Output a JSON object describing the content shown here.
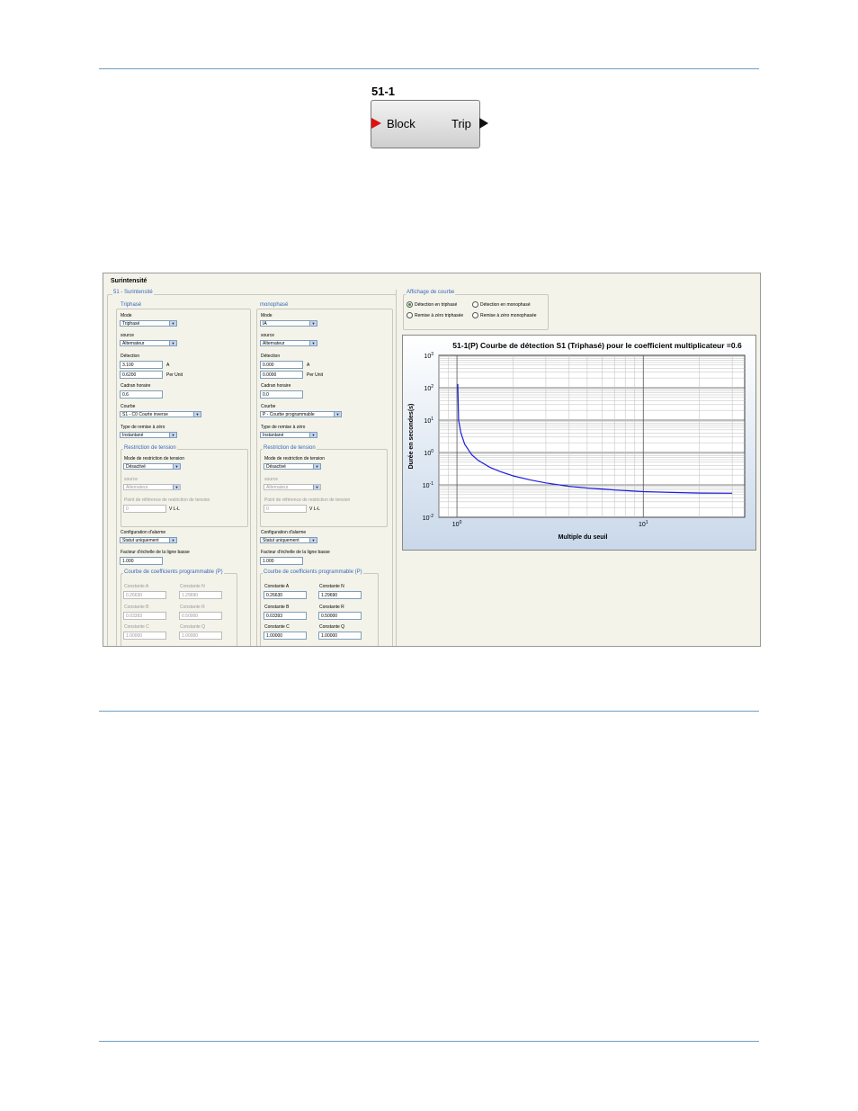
{
  "block": {
    "title": "51-1",
    "input_label": "Block",
    "output_label": "Trip"
  },
  "window": {
    "title": "Surintensité",
    "group_title": "51 - Surintensité"
  },
  "triphase": {
    "title": "Triphasé",
    "mode_label": "Mode",
    "mode_value": "Triphasé",
    "source_label": "source",
    "source_value": "Alternateur",
    "detection_label": "Détection",
    "detection_value": "3.100",
    "detection_unit": "A",
    "perunit_value": "0.6200",
    "perunit_unit": "Per Unit",
    "cadran_label": "Cadran horaire",
    "cadran_value": "0.6",
    "courbe_label": "Courbe",
    "courbe_value": "S1 - C0 Courte inverse",
    "reset_label": "Type de remise à zéro",
    "reset_value": "Instantané",
    "restriction": {
      "title": "Restriction de tension",
      "mode_label": "Mode de restriction de tension",
      "mode_value": "Désactivé",
      "source_label": "source",
      "source_value": "Alternateur",
      "point_label": "Point de référence de restriction de tension",
      "point_value": "0",
      "point_unit": "V L-L"
    },
    "alarm_label": "Configuration d'alarme",
    "alarm_value": "Statut uniquement",
    "facteur_label": "Facteur d'échelle de la ligne basse",
    "facteur_value": "1.000",
    "coeffs": {
      "title": "Courbe de coefficients programmable (P)",
      "a_label": "Constante A",
      "a_value": "0.26630",
      "n_label": "Constante N",
      "n_value": "1.29690",
      "b_label": "Constante B",
      "b_value": "0.03393",
      "r_label": "Constante R",
      "r_value": "0.50000",
      "c_label": "Constante C",
      "c_value": "1.00000",
      "q_label": "Constante Q",
      "q_value": "1.00000"
    }
  },
  "monophase": {
    "title": "monophasé",
    "mode_label": "Mode",
    "mode_value": "IA",
    "source_label": "source",
    "source_value": "Alternateur",
    "detection_label": "Détection",
    "detection_value": "0.000",
    "detection_unit": "A",
    "perunit_value": "0.0000",
    "perunit_unit": "Per Unit",
    "cadran_label": "Cadran horaire",
    "cadran_value": "0.0",
    "courbe_label": "Courbe",
    "courbe_value": "P - Courbe programmable",
    "reset_label": "Type de remise à zéro",
    "reset_value": "Instantané",
    "restriction": {
      "title": "Restriction de tension",
      "mode_label": "Mode de restriction de tension",
      "mode_value": "Désactivé",
      "source_label": "source",
      "source_value": "Alternateur",
      "point_label": "Point de référence de restriction de tension",
      "point_value": "0",
      "point_unit": "V L-L"
    },
    "alarm_label": "Configuration d'alarme",
    "alarm_value": "Statut uniquement",
    "facteur_label": "Facteur d'échelle de la ligne basse",
    "facteur_value": "1.000",
    "coeffs": {
      "title": "Courbe de coefficients programmable (P)",
      "a_label": "Constante A",
      "a_value": "0.26630",
      "n_label": "Constante N",
      "n_value": "1.29690",
      "b_label": "Constante B",
      "b_value": "0.03393",
      "r_label": "Constante R",
      "r_value": "0.50000",
      "c_label": "Constante C",
      "c_value": "1.00000",
      "q_label": "Constante Q",
      "q_value": "1.00000"
    }
  },
  "affichage": {
    "title": "Affichage de courbe",
    "options": [
      "Détection en triphasé",
      "Détection en monophasé",
      "Remise à zéro triphasée",
      "Remise à zéro monophasée"
    ],
    "selected": 0
  },
  "colors": {
    "curve": "#1f1fdd",
    "accent": "#3a68b8"
  },
  "chart_data": {
    "type": "line",
    "title": "51-1(P) Courbe de détection S1 (Triphasé) pour le coefficient multiplicateur =0.6",
    "xlabel": "Multiple du seuil",
    "ylabel": "Durée en secondes(s)",
    "xscale": "log",
    "yscale": "log",
    "xlim": [
      0.8,
      35
    ],
    "ylim": [
      0.01,
      1000
    ],
    "yticks": [
      "10^3",
      "10^2",
      "10^1",
      "10^0",
      "10^-1",
      "10^-2"
    ],
    "xticks": [
      "10^0",
      "10^1"
    ],
    "grid": true,
    "series": [
      {
        "x": [
          1.01,
          1.02,
          1.05,
          1.1,
          1.2,
          1.3,
          1.5,
          1.7,
          2,
          2.5,
          3,
          4,
          5,
          7,
          10,
          15,
          20,
          30
        ],
        "y": [
          130,
          10,
          4,
          1.8,
          0.85,
          0.57,
          0.35,
          0.26,
          0.19,
          0.14,
          0.115,
          0.09,
          0.08,
          0.07,
          0.062,
          0.058,
          0.056,
          0.055
        ]
      }
    ]
  }
}
